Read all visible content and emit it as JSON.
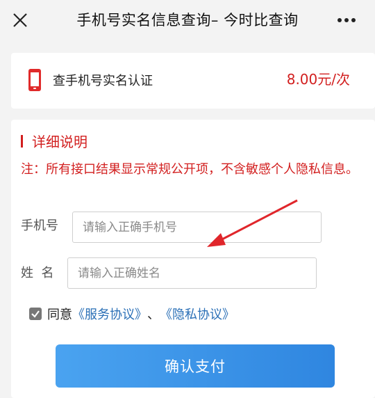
{
  "header": {
    "title": "手机号实名信息查询– 今时比查询",
    "close_icon": "close-icon",
    "more_icon": "more-icon"
  },
  "service": {
    "name": "查手机号实名认证",
    "price": "8.00元/次",
    "icon": "phone-icon"
  },
  "details": {
    "section_title": "详细说明",
    "notice": "注：所有接口结果显示常规公开项，不含敏感个人隐私信息。"
  },
  "form": {
    "phone_label": "手机号",
    "phone_placeholder": "请输入正确手机号",
    "phone_value": "",
    "name_label": "姓  名",
    "name_placeholder": "请输入正确姓名",
    "name_value": ""
  },
  "agreement": {
    "checked": true,
    "prefix": "同意",
    "service_link": "《服务协议》",
    "separator": "、",
    "privacy_link": "《隐私协议》"
  },
  "submit": {
    "label": "确认支付"
  },
  "colors": {
    "accent_red": "#d21f1f",
    "link_blue": "#2a6fb6",
    "button_blue": "#3a93e8"
  }
}
